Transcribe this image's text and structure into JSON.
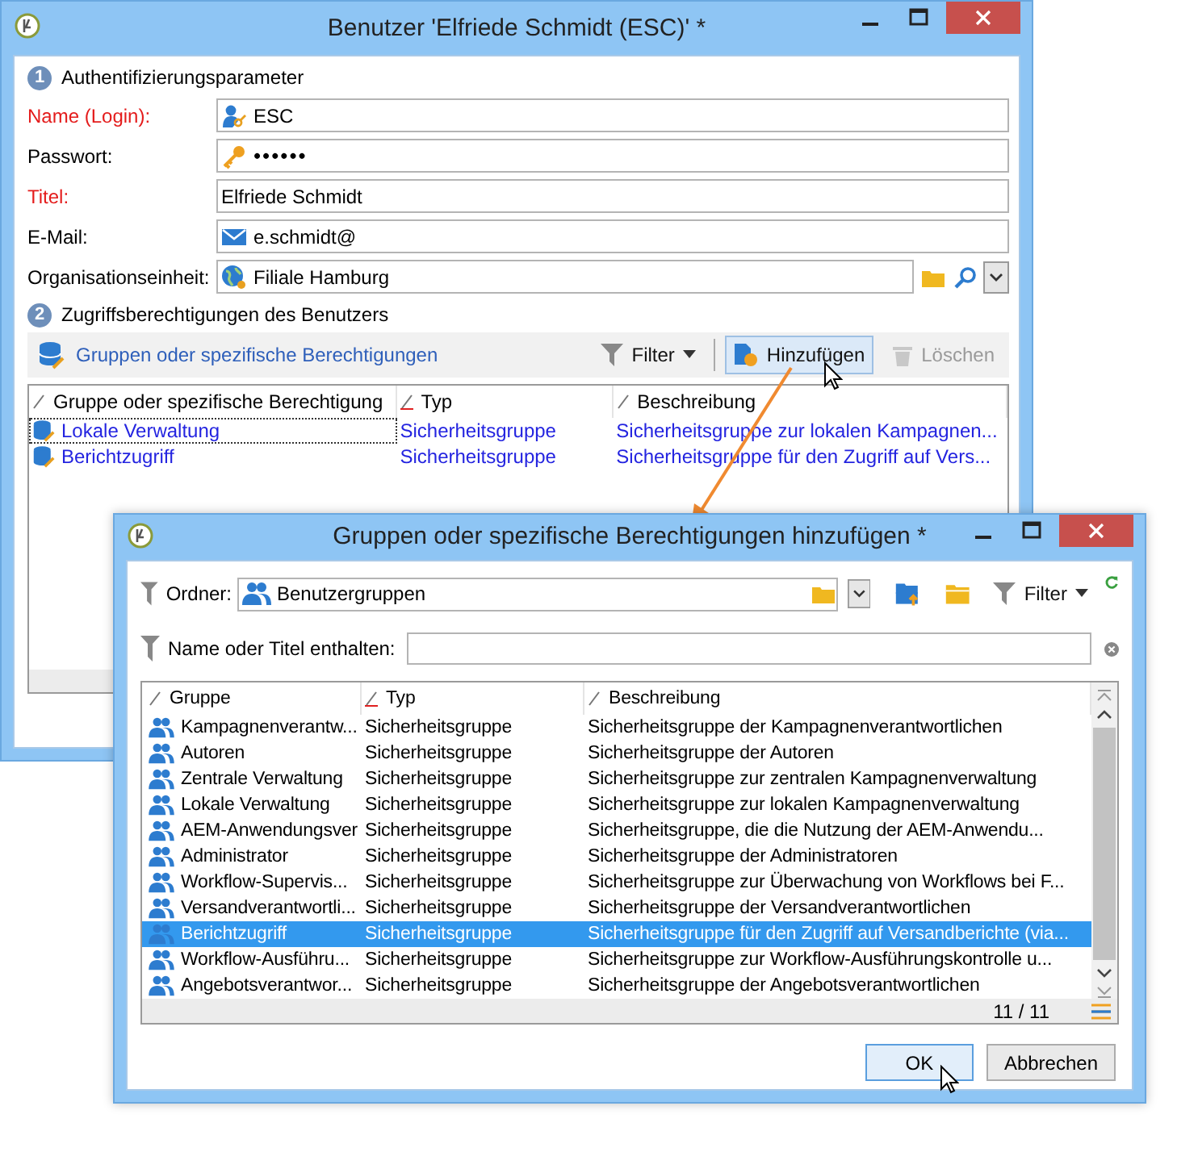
{
  "user_window": {
    "title": "Benutzer 'Elfriede Schmidt (ESC)' *",
    "section_1": {
      "number": "1",
      "label": "Authentifizierungsparameter"
    },
    "fields": [
      {
        "kind": "login",
        "label": "Name (Login):",
        "required": true,
        "value": "ESC"
      },
      {
        "kind": "password",
        "label": "Passwort:",
        "required": false,
        "value": "••••••"
      },
      {
        "kind": "text",
        "label": "Titel:",
        "required": true,
        "value": "Elfriede Schmidt"
      },
      {
        "kind": "email",
        "label": "E-Mail:",
        "required": false,
        "value": "e.schmidt@"
      },
      {
        "kind": "org",
        "label": "Organisationseinheit:",
        "required": false,
        "value": "Filiale Hamburg"
      }
    ],
    "section_2": {
      "number": "2",
      "label": "Zugriffsberechtigungen des Benutzers"
    },
    "toolbar": {
      "title": "Gruppen oder spezifische Berechtigungen",
      "buttons": [
        {
          "kind": "filter",
          "label": "Filter",
          "hovered": false,
          "disabled": false
        },
        {
          "kind": "add",
          "label": "Hinzufügen",
          "hovered": true,
          "disabled": false
        },
        {
          "kind": "delete",
          "label": "Löschen",
          "hovered": false,
          "disabled": true
        }
      ]
    },
    "table": {
      "columns": [
        "Gruppe oder spezifische Berechtigung",
        "Typ",
        "Beschreibung"
      ],
      "rows": [
        {
          "group": "Lokale Verwaltung",
          "type": "Sicherheitsgruppe",
          "description": "Sicherheitsgruppe zur lokalen Kampagnen..."
        },
        {
          "group": "Berichtzugriff",
          "type": "Sicherheitsgruppe",
          "description": "Sicherheitsgruppe für den Zugriff auf Vers..."
        }
      ]
    }
  },
  "add_dialog": {
    "title": "Gruppen oder spezifische Berechtigungen hinzufügen *",
    "folder": {
      "label": "Ordner:",
      "value": "Benutzergruppen"
    },
    "filter_label": "Filter",
    "search": {
      "label": "Name oder Titel enthalten:"
    },
    "table": {
      "columns": [
        "Gruppe",
        "Typ",
        "Beschreibung"
      ],
      "rows": [
        {
          "group": "Kampagnenverantw...",
          "type": "Sicherheitsgruppe",
          "description": "Sicherheitsgruppe der Kampagnenverantwortlichen",
          "selected": false
        },
        {
          "group": "Autoren",
          "type": "Sicherheitsgruppe",
          "description": "Sicherheitsgruppe der Autoren",
          "selected": false
        },
        {
          "group": "Zentrale Verwaltung",
          "type": "Sicherheitsgruppe",
          "description": "Sicherheitsgruppe zur zentralen Kampagnenverwaltung",
          "selected": false
        },
        {
          "group": "Lokale Verwaltung",
          "type": "Sicherheitsgruppe",
          "description": "Sicherheitsgruppe zur lokalen Kampagnenverwaltung",
          "selected": false
        },
        {
          "group": "AEM-Anwendungsver",
          "type": "Sicherheitsgruppe",
          "description": "Sicherheitsgruppe, die die Nutzung der AEM-Anwendu...",
          "selected": false
        },
        {
          "group": "Administrator",
          "type": "Sicherheitsgruppe",
          "description": "Sicherheitsgruppe der Administratoren",
          "selected": false
        },
        {
          "group": "Workflow-Supervis...",
          "type": "Sicherheitsgruppe",
          "description": "Sicherheitsgruppe zur Überwachung von Workflows bei F...",
          "selected": false
        },
        {
          "group": "Versandverantwortli...",
          "type": "Sicherheitsgruppe",
          "description": "Sicherheitsgruppe der Versandverantwortlichen",
          "selected": false
        },
        {
          "group": "Berichtzugriff",
          "type": "Sicherheitsgruppe",
          "description": "Sicherheitsgruppe für den Zugriff auf Versandberichte (via...",
          "selected": true
        },
        {
          "group": "Workflow-Ausführu...",
          "type": "Sicherheitsgruppe",
          "description": "Sicherheitsgruppe zur Workflow-Ausführungskontrolle u...",
          "selected": false
        },
        {
          "group": "Angebotsverantwor...",
          "type": "Sicherheitsgruppe",
          "description": "Sicherheitsgruppe der Angebotsverantwortlichen",
          "selected": false
        }
      ]
    },
    "count": "11 / 11",
    "buttons": [
      {
        "label": "OK",
        "hovered": true
      },
      {
        "label": "Abbrechen",
        "hovered": false
      }
    ]
  }
}
